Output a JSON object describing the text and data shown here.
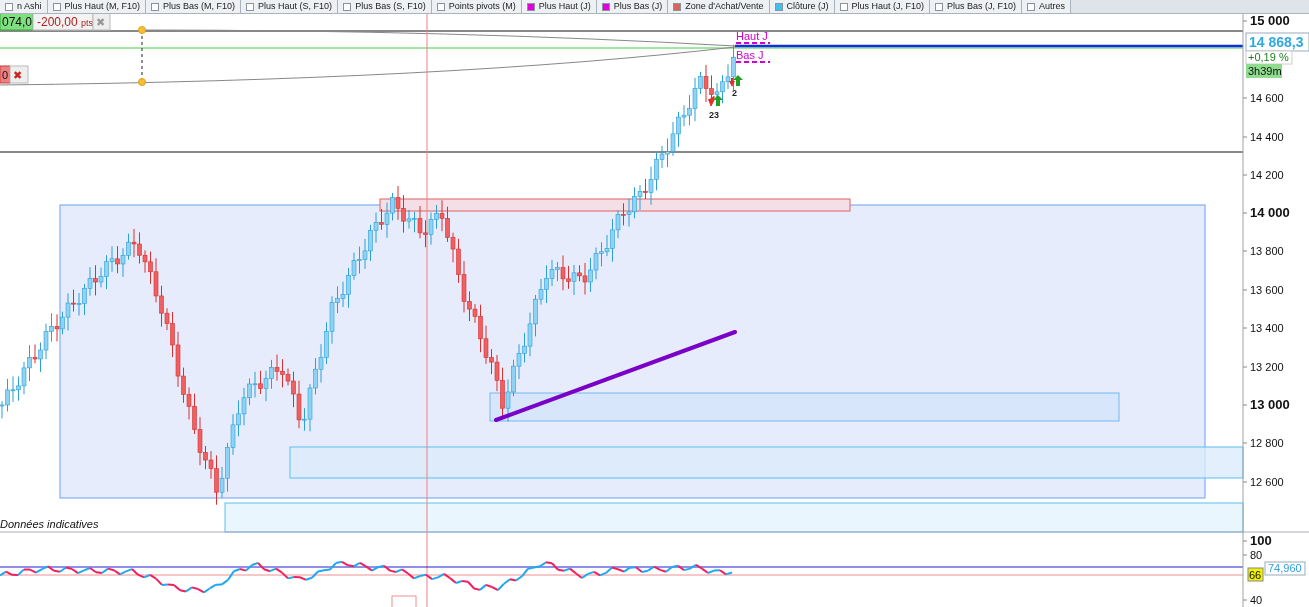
{
  "legend_tabs": [
    {
      "label": "n Ashi",
      "color": "#ffffff"
    },
    {
      "label": "Plus Haut (M, F10)",
      "color": "#ffffff"
    },
    {
      "label": "Plus Bas (M, F10)",
      "color": "#ffffff"
    },
    {
      "label": "Plus Haut (S, F10)",
      "color": "#ffffff"
    },
    {
      "label": "Plus Bas (S, F10)",
      "color": "#ffffff"
    },
    {
      "label": "Points pivots (M)",
      "color": "#ffffff"
    },
    {
      "label": "Plus Haut (J)",
      "color": "#e000e0"
    },
    {
      "label": "Plus Bas (J)",
      "color": "#e000e0"
    },
    {
      "label": "Zone d'Achat/Vente",
      "color": "#e0605a"
    },
    {
      "label": "Clôture (J)",
      "color": "#40c0f0"
    },
    {
      "label": "Plus Haut (J, F10)",
      "color": "#ffffff"
    },
    {
      "label": "Plus Bas (J, F10)",
      "color": "#ffffff"
    },
    {
      "label": "Autres",
      "color": "#ffffff"
    }
  ],
  "orders": [
    {
      "price": "074,0",
      "pnl": "-200,00",
      "unit": "pts",
      "close": "✖",
      "kind": "take"
    },
    {
      "price": "0",
      "close": "✖",
      "kind": "stop"
    }
  ],
  "price_axis": [
    {
      "label": "15 000",
      "major": true
    },
    {
      "label": "14 600",
      "major": false
    },
    {
      "label": "14 400",
      "major": false
    },
    {
      "label": "14 200",
      "major": false
    },
    {
      "label": "14 000",
      "major": true
    },
    {
      "label": "13 800",
      "major": false
    },
    {
      "label": "13 600",
      "major": false
    },
    {
      "label": "13 400",
      "major": false
    },
    {
      "label": "13 200",
      "major": false
    },
    {
      "label": "13 000",
      "major": true
    },
    {
      "label": "12 800",
      "major": false
    },
    {
      "label": "12 600",
      "major": false
    }
  ],
  "last_price": "14 868,3",
  "change": "+0,19 %",
  "countdown": "3h39m",
  "markers": {
    "high": "Haut J",
    "low": "Bas J",
    "counts": [
      "23",
      "2"
    ]
  },
  "disclaimer": "Données indicatives",
  "rsi": {
    "axis": [
      {
        "label": "100",
        "major": true
      },
      {
        "label": "80",
        "major": false
      },
      {
        "label": "40",
        "major": false
      }
    ],
    "reading": "74,960",
    "value": "66"
  }
}
